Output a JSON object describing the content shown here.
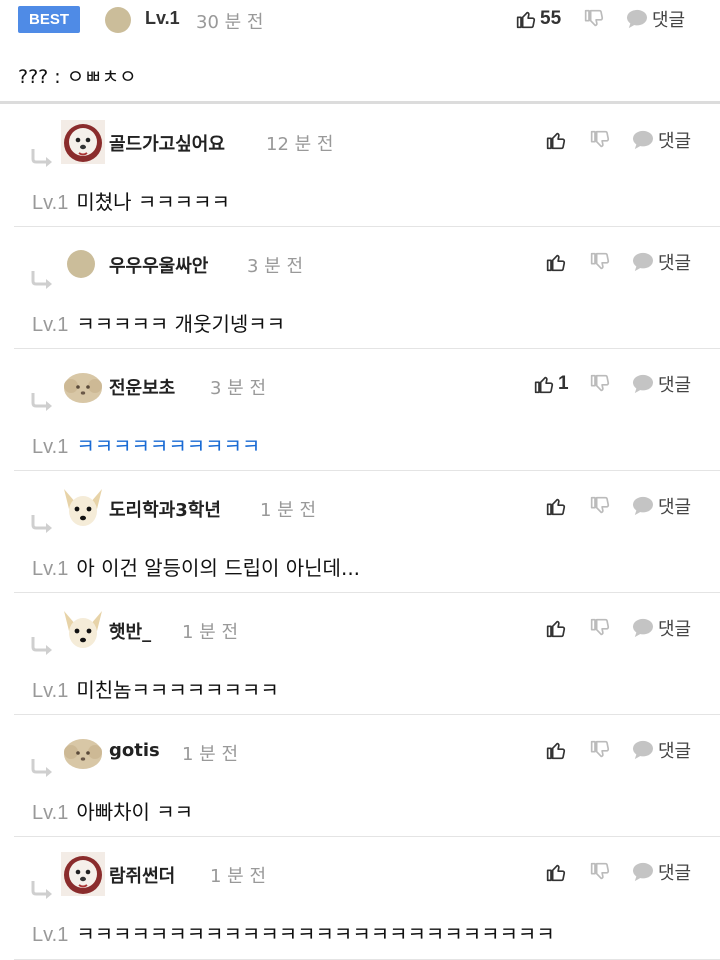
{
  "best": {
    "badge": "BEST",
    "level": "Lv.1",
    "time": "30 분 전",
    "likes": "55",
    "reply_label": "댓글",
    "text": "??? : ㅇㅃㅊㅇ"
  },
  "replies": [
    {
      "name": "골드가고싶어요",
      "time": "12 분 전",
      "level": "Lv.1",
      "text": "미쳤나 ㅋㅋㅋㅋㅋ",
      "likes": "",
      "reply_label": "댓글",
      "avatar": "dog-fluffy-icon"
    },
    {
      "name": "우우우울싸안",
      "time": "3 분 전",
      "level": "Lv.1",
      "text": "ㅋㅋㅋㅋㅋ 개웃기넹ㅋㅋ",
      "likes": "",
      "reply_label": "댓글",
      "avatar": "default-avatar-icon"
    },
    {
      "name": "전운보초",
      "time": "3 분 전",
      "level": "Lv.1",
      "text": "ㅋㅋㅋㅋㅋㅋㅋㅋㅋㅋ",
      "likes": "1",
      "reply_label": "댓글",
      "avatar": "poodle-icon",
      "text_color": "#1a6bd4"
    },
    {
      "name": "도리학과3학년",
      "time": "1 분 전",
      "level": "Lv.1",
      "text": "아 이건 알등이의 드립이 아닌데...",
      "likes": "",
      "reply_label": "댓글",
      "avatar": "chihuahua-icon"
    },
    {
      "name": "햇반_",
      "time": "1 분 전",
      "level": "Lv.1",
      "text": "미친놈ㅋㅋㅋㅋㅋㅋㅋㅋ",
      "likes": "",
      "reply_label": "댓글",
      "avatar": "chihuahua-icon"
    },
    {
      "name": "gotis",
      "time": "1 분 전",
      "level": "Lv.1",
      "text": "아빠차이 ㅋㅋ",
      "likes": "",
      "reply_label": "댓글",
      "avatar": "poodle-icon"
    },
    {
      "name": "람쥐썬더",
      "time": "1 분 전",
      "level": "Lv.1",
      "text": "ㅋㅋㅋㅋㅋㅋㅋㅋㅋㅋㅋㅋㅋㅋㅋㅋㅋㅋㅋㅋㅋㅋㅋㅋㅋㅋ",
      "likes": "",
      "reply_label": "댓글",
      "avatar": "dog-fluffy-icon"
    }
  ],
  "colors": {
    "badge": "#4f8be6",
    "timestamp": "#999999",
    "blue_text": "#1a6bd4",
    "divider": "#dcdcdc"
  }
}
